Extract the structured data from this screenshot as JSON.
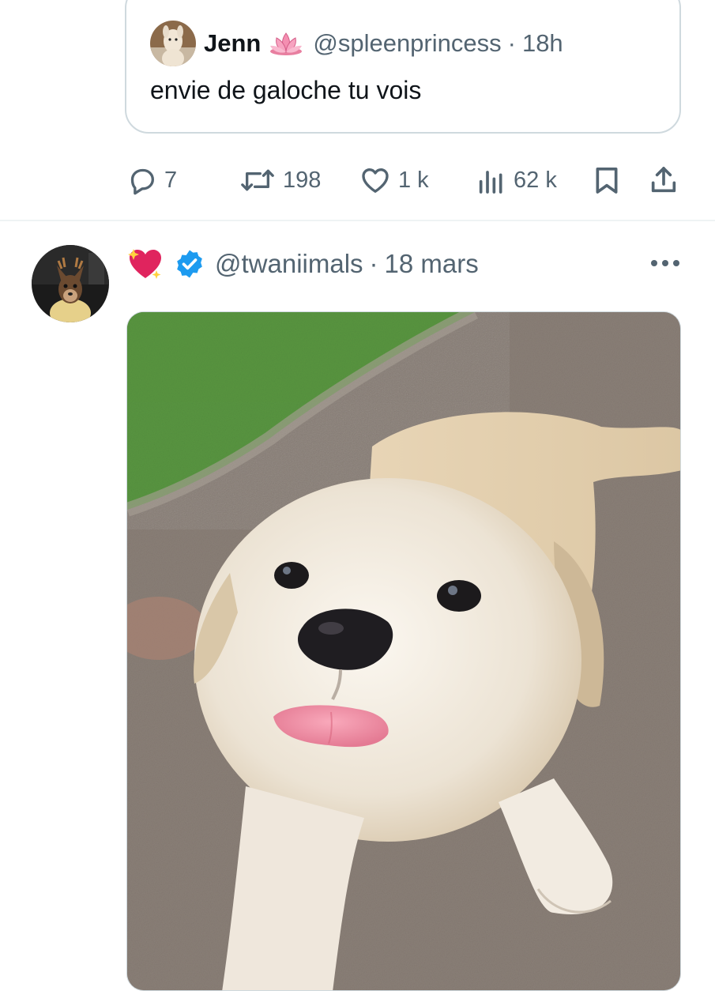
{
  "quoted_tweet": {
    "author_name": "Jenn",
    "author_handle": "@spleenprincess",
    "separator": "·",
    "time": "18h",
    "text": "envie de galoche tu vois",
    "name_emoji": "lotus-emoji"
  },
  "actions": {
    "replies": "7",
    "retweets": "198",
    "likes": "1 k",
    "views": "62 k"
  },
  "tweet": {
    "author_handle": "@twaniimals",
    "separator": "·",
    "date": "18 mars",
    "verified": true,
    "name_emoji": "sparkling-heart-emoji",
    "media": "photo of a white puppy sticking out its tongue on a path"
  },
  "colors": {
    "secondary_text": "#536471",
    "border": "#cfd9de",
    "verified_blue": "#1d9bf0",
    "heart_red": "#e0245e"
  }
}
